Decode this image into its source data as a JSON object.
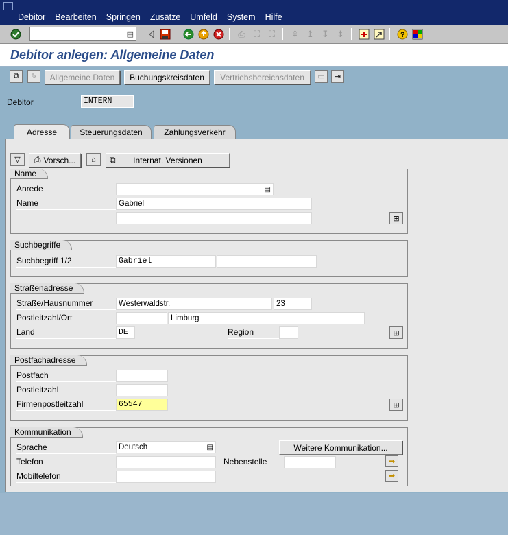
{
  "menu": {
    "items": [
      "Debitor",
      "Bearbeiten",
      "Springen",
      "Zusätze",
      "Umfeld",
      "System",
      "Hilfe"
    ]
  },
  "toolbar": {
    "command_value": ""
  },
  "title": "Debitor anlegen: Allgemeine Daten",
  "app_toolbar": {
    "allgemeine_daten": "Allgemeine Daten",
    "buchungskreisdaten": "Buchungskreisdaten",
    "vertriebsbereichsdaten": "Vertriebsbereichsdaten"
  },
  "header": {
    "debitor_label": "Debitor",
    "debitor_value": "INTERN"
  },
  "tabs": [
    {
      "label": "Adresse",
      "active": true
    },
    {
      "label": "Steuerungsdaten",
      "active": false
    },
    {
      "label": "Zahlungsverkehr",
      "active": false
    }
  ],
  "panel_toolbar": {
    "preview_label": "Vorsch...",
    "intl_versions_label": "Internat. Versionen"
  },
  "name_group": {
    "title": "Name",
    "anrede_label": "Anrede",
    "anrede_value": "",
    "name_label": "Name",
    "name_value": "Gabriel",
    "name2_value": ""
  },
  "search_group": {
    "title": "Suchbegriffe",
    "search_label": "Suchbegriff 1/2",
    "search1_value": "Gabriel",
    "search2_value": ""
  },
  "street_group": {
    "title": "Straßenadresse",
    "street_label": "Straße/Hausnummer",
    "street_value": "Westerwaldstr.",
    "house_value": "23",
    "plz_label": "Postleitzahl/Ort",
    "plz_value": "",
    "city_value": "Limburg",
    "country_label": "Land",
    "country_value": "DE",
    "region_label": "Region",
    "region_value": ""
  },
  "pobox_group": {
    "title": "Postfachadresse",
    "postfach_label": "Postfach",
    "postfach_value": "",
    "plz_label": "Postleitzahl",
    "plz_value": "",
    "company_plz_label": "Firmenpostleitzahl",
    "company_plz_value": "65547"
  },
  "comm_group": {
    "title": "Kommunikation",
    "language_label": "Sprache",
    "language_value": "Deutsch",
    "more_comm_label": "Weitere Kommunikation...",
    "phone_label": "Telefon",
    "phone_value": "",
    "extension_label": "Nebenstelle",
    "extension_value": "",
    "mobile_label": "Mobiltelefon",
    "mobile_value": ""
  }
}
